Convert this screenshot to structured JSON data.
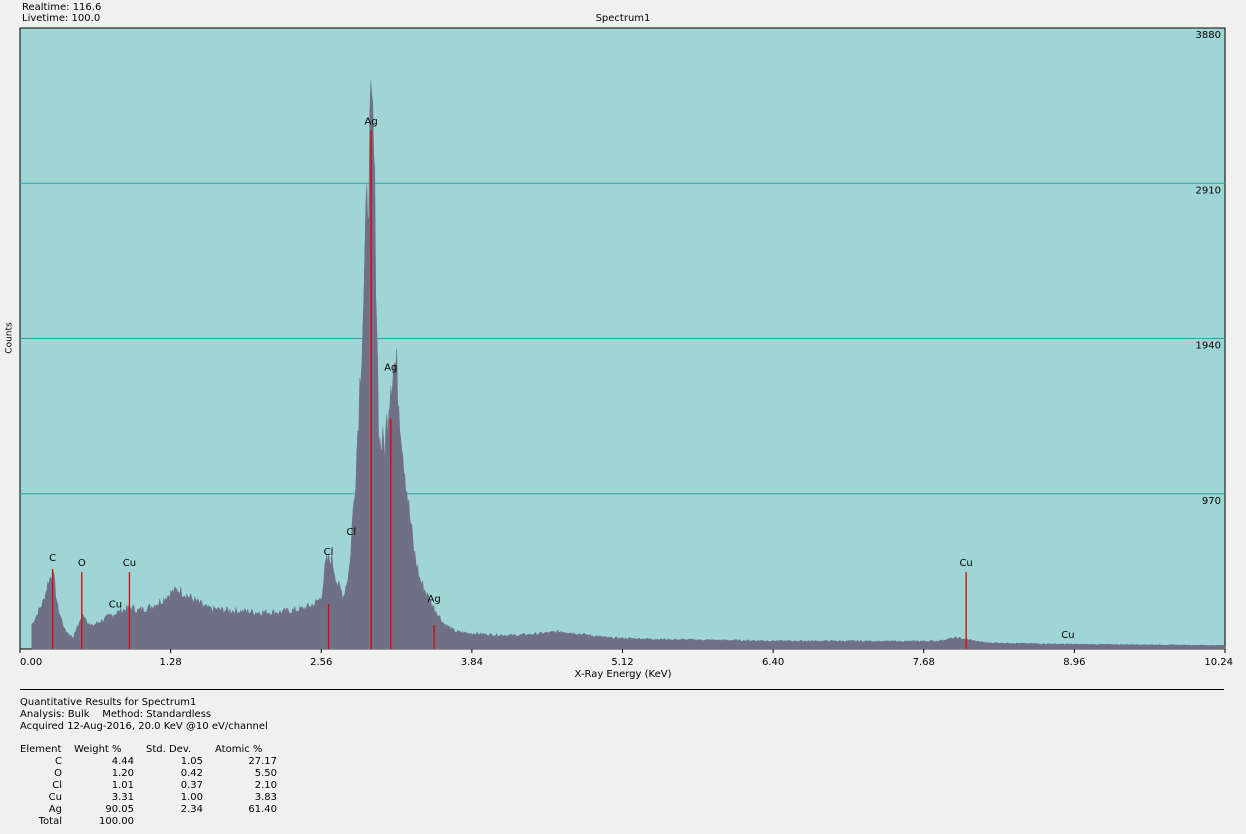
{
  "header": {
    "realtime": "Realtime: 116.6",
    "livetime": "Livetime: 100.0"
  },
  "chart_data": {
    "type": "area",
    "title": "Spectrum1",
    "xlabel": "X-Ray Energy (KeV)",
    "ylabel": "Counts",
    "xlim": [
      0,
      10.24
    ],
    "ylim": [
      0,
      3880
    ],
    "x_ticks": [
      "0.00",
      "1.28",
      "2.56",
      "3.84",
      "5.12",
      "6.40",
      "7.68",
      "8.96",
      "10.24"
    ],
    "y_ticks": [
      "970",
      "1940",
      "2910",
      "3880"
    ],
    "grid": true,
    "colors": {
      "background": "#9fd5d5",
      "fill": "#6f6f85",
      "grid": "#2aa3a3",
      "marker": "#e00000"
    },
    "series": [
      {
        "x": [
          0.1,
          0.2,
          0.24,
          0.28,
          0.32,
          0.38,
          0.45,
          0.5,
          0.54,
          0.6,
          0.7,
          0.8,
          0.9,
          0.95,
          1.0,
          1.1,
          1.2,
          1.28,
          1.35,
          1.45,
          1.6,
          1.8,
          2.0,
          2.2,
          2.4,
          2.5,
          2.56,
          2.6,
          2.65,
          2.7,
          2.75,
          2.8,
          2.86,
          2.92,
          2.96,
          2.98,
          3.0,
          3.02,
          3.05,
          3.1,
          3.15,
          3.18,
          3.2,
          3.25,
          3.3,
          3.35,
          3.4,
          3.5,
          3.6,
          3.7,
          3.8,
          4.0,
          4.2,
          4.4,
          4.6,
          5.0,
          5.5,
          6.0,
          6.5,
          7.0,
          7.5,
          7.8,
          7.95,
          8.05,
          8.2,
          8.5,
          8.9,
          9.3,
          9.8,
          10.24
        ],
        "values": [
          150,
          300,
          420,
          480,
          260,
          120,
          70,
          160,
          220,
          140,
          180,
          220,
          250,
          260,
          240,
          260,
          300,
          350,
          370,
          320,
          250,
          240,
          230,
          230,
          250,
          280,
          320,
          540,
          560,
          400,
          330,
          500,
          1200,
          2200,
          2950,
          3230,
          3250,
          2600,
          1300,
          1260,
          1700,
          1790,
          1740,
          1280,
          900,
          600,
          430,
          280,
          160,
          110,
          100,
          90,
          85,
          95,
          110,
          70,
          60,
          55,
          50,
          50,
          48,
          50,
          70,
          60,
          40,
          35,
          30,
          28,
          25,
          22
        ]
      }
    ],
    "peak_labels": [
      {
        "label": "C",
        "x": 0.277,
        "marker": 500
      },
      {
        "label": "O",
        "x": 0.525,
        "marker": 480
      },
      {
        "label": "Cu",
        "x": 0.93,
        "marker": 480
      },
      {
        "label": "Cu",
        "x": 0.811,
        "marker": 0
      },
      {
        "label": "Cl",
        "x": 2.622,
        "marker": 280
      },
      {
        "label": "Cl",
        "x": 2.815,
        "marker": 0
      },
      {
        "label": "Ag",
        "x": 2.984,
        "marker": 3240
      },
      {
        "label": "Ag",
        "x": 3.151,
        "marker": 1440
      },
      {
        "label": "Ag",
        "x": 3.519,
        "marker": 150
      },
      {
        "label": "Cu",
        "x": 8.04,
        "marker": 480
      },
      {
        "label": "Cu",
        "x": 8.905,
        "marker": 0
      }
    ]
  },
  "report": {
    "title": "Quantitative Results for Spectrum1",
    "analysis": "Analysis: Bulk    Method: Standardless",
    "acquired": "Acquired 12-Aug-2016, 20.0 KeV @10 eV/channel",
    "columns": [
      "Element",
      "Weight %",
      "Std. Dev.",
      "Atomic %"
    ],
    "rows": [
      [
        "C",
        "4.44",
        "1.05",
        "27.17"
      ],
      [
        "O",
        "1.20",
        "0.42",
        "5.50"
      ],
      [
        "Cl",
        "1.01",
        "0.37",
        "2.10"
      ],
      [
        "Cu",
        "3.31",
        "1.00",
        "3.83"
      ],
      [
        "Ag",
        "90.05",
        "2.34",
        "61.40"
      ],
      [
        "Total",
        "100.00",
        "",
        ""
      ]
    ]
  }
}
